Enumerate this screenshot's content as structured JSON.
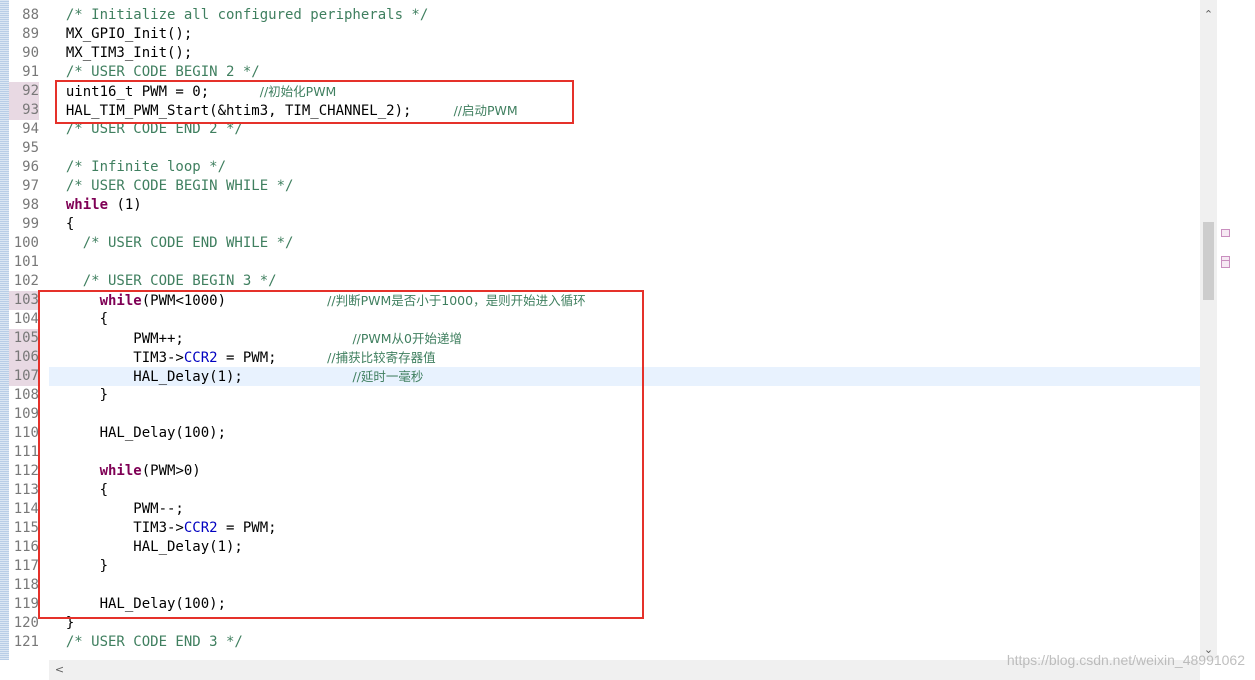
{
  "code_lines": [
    {
      "n": "88",
      "segs": [
        {
          "t": "/* Initialize all configured peripherals */",
          "c": "cmt"
        }
      ]
    },
    {
      "n": "89",
      "segs": [
        {
          "t": "MX_GPIO_Init();"
        }
      ]
    },
    {
      "n": "90",
      "segs": [
        {
          "t": "MX_TIM3_Init();"
        }
      ]
    },
    {
      "n": "91",
      "segs": [
        {
          "t": "/* USER CODE BEGIN 2 */",
          "c": "cmt"
        }
      ]
    },
    {
      "n": "92",
      "segs": [
        {
          "t": "uint16_t PWM = 0;      "
        },
        {
          "t": "//初始化PWM",
          "c": "cn"
        }
      ]
    },
    {
      "n": "93",
      "segs": [
        {
          "t": "HAL_TIM_PWM_Start(&htim3, TIM_CHANNEL_2);     "
        },
        {
          "t": "//启动PWM",
          "c": "cn"
        }
      ]
    },
    {
      "n": "94",
      "segs": [
        {
          "t": "/* USER CODE END 2 */",
          "c": "cmt"
        }
      ]
    },
    {
      "n": "95",
      "segs": []
    },
    {
      "n": "96",
      "segs": [
        {
          "t": "/* Infinite loop */",
          "c": "cmt"
        }
      ]
    },
    {
      "n": "97",
      "segs": [
        {
          "t": "/* USER CODE BEGIN WHILE */",
          "c": "cmt"
        }
      ]
    },
    {
      "n": "98",
      "segs": [
        {
          "t": "while",
          "c": "kw"
        },
        {
          "t": " (1)"
        }
      ]
    },
    {
      "n": "99",
      "segs": [
        {
          "t": "{"
        }
      ]
    },
    {
      "n": "100",
      "segs": [
        {
          "t": "  "
        },
        {
          "t": "/* USER CODE END WHILE */",
          "c": "cmt"
        }
      ]
    },
    {
      "n": "101",
      "segs": []
    },
    {
      "n": "102",
      "segs": [
        {
          "t": "  "
        },
        {
          "t": "/* USER CODE BEGIN 3 */",
          "c": "cmt"
        }
      ]
    },
    {
      "n": "103",
      "segs": [
        {
          "t": "    "
        },
        {
          "t": "while",
          "c": "kw"
        },
        {
          "t": "(PWM<1000)            "
        },
        {
          "t": "//判断PWM是否小于1000，是则开始进入循环",
          "c": "cn"
        }
      ]
    },
    {
      "n": "104",
      "segs": [
        {
          "t": "    {"
        }
      ]
    },
    {
      "n": "105",
      "segs": [
        {
          "t": "        PWM++;                    "
        },
        {
          "t": "//PWM从0开始递增",
          "c": "cn"
        }
      ]
    },
    {
      "n": "106",
      "segs": [
        {
          "t": "        TIM3->"
        },
        {
          "t": "CCR2",
          "c": "fld"
        },
        {
          "t": " = PWM;      "
        },
        {
          "t": "//捕获比较寄存器值",
          "c": "cn"
        }
      ]
    },
    {
      "n": "107",
      "segs": [
        {
          "t": "        HAL_Delay(1);             "
        },
        {
          "t": "//延时一毫秒",
          "c": "cn"
        }
      ]
    },
    {
      "n": "108",
      "segs": [
        {
          "t": "    }"
        }
      ]
    },
    {
      "n": "109",
      "segs": []
    },
    {
      "n": "110",
      "segs": [
        {
          "t": "    HAL_Delay(100);"
        }
      ]
    },
    {
      "n": "111",
      "segs": []
    },
    {
      "n": "112",
      "segs": [
        {
          "t": "    "
        },
        {
          "t": "while",
          "c": "kw"
        },
        {
          "t": "(PWM>0)"
        }
      ]
    },
    {
      "n": "113",
      "segs": [
        {
          "t": "    {"
        }
      ]
    },
    {
      "n": "114",
      "segs": [
        {
          "t": "        PWM--;"
        }
      ]
    },
    {
      "n": "115",
      "segs": [
        {
          "t": "        TIM3->"
        },
        {
          "t": "CCR2",
          "c": "fld"
        },
        {
          "t": " = PWM;"
        }
      ]
    },
    {
      "n": "116",
      "segs": [
        {
          "t": "        HAL_Delay(1);"
        }
      ]
    },
    {
      "n": "117",
      "segs": [
        {
          "t": "    }"
        }
      ]
    },
    {
      "n": "118",
      "segs": []
    },
    {
      "n": "119",
      "segs": [
        {
          "t": "    HAL_Delay(100);"
        }
      ]
    },
    {
      "n": "120",
      "segs": [
        {
          "t": "}"
        }
      ]
    },
    {
      "n": "121",
      "segs": [
        {
          "t": "/* USER CODE END 3 */",
          "c": "cmt"
        }
      ]
    }
  ],
  "current_line": "107",
  "changed_lines": [
    "92",
    "93",
    "103",
    "105",
    "106",
    "107"
  ],
  "scrollbar": {
    "up": "⌃",
    "down": "⌄",
    "left": "<"
  },
  "watermark": "https://blog.csdn.net/weixin_48991062",
  "colors": {
    "comment": "#3f7f5f",
    "keyword": "#7f0055",
    "field": "#0000c0",
    "highlight_box": "#e5312a",
    "current_line": "#e8f2fe",
    "line_number": "#787878"
  }
}
